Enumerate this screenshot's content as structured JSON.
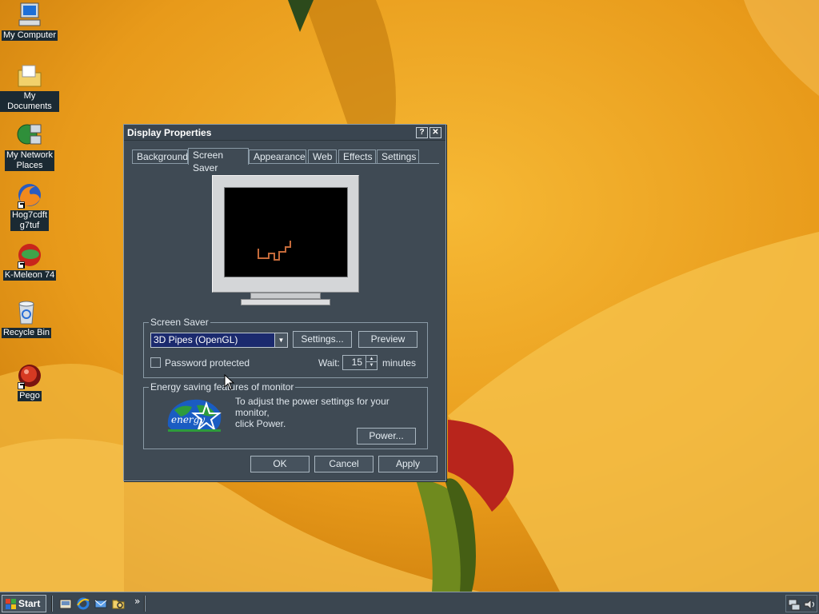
{
  "desktop": {
    "icons": [
      {
        "label": "My Computer",
        "icon": "computer-icon"
      },
      {
        "label": "My Documents",
        "icon": "folder-icon"
      },
      {
        "label": "My Network",
        "label2": "Places",
        "icon": "network-icon"
      },
      {
        "label": "Hog7cdft",
        "label2": "g7tuf",
        "icon": "firefox-icon"
      },
      {
        "label": "K-Meleon 74",
        "icon": "kmeleon-icon"
      },
      {
        "label": "Recycle Bin",
        "icon": "recycle-bin-icon"
      },
      {
        "label": "Pego",
        "icon": "pego-icon"
      }
    ]
  },
  "dialog": {
    "title": "Display Properties",
    "help_label": "?",
    "close_label": "✕",
    "tabs": [
      "Background",
      "Screen Saver",
      "Appearance",
      "Web",
      "Effects",
      "Settings"
    ],
    "active_tab": "Screen Saver",
    "screensaver": {
      "group_title": "Screen Saver",
      "selected": "3D Pipes (OpenGL)",
      "settings_label": "Settings...",
      "preview_label": "Preview",
      "password_label": "Password protected",
      "password_checked": false,
      "wait_label": "Wait:",
      "wait_value": "15",
      "minutes_label": "minutes"
    },
    "energy": {
      "group_title": "Energy saving features of monitor",
      "description_line1": "To adjust the power settings for your monitor,",
      "description_line2": "click Power.",
      "power_label": "Power...",
      "logo_text": "energy"
    },
    "ok_label": "OK",
    "cancel_label": "Cancel",
    "apply_label": "Apply"
  },
  "taskbar": {
    "start_label": "Start",
    "chevron_label": "»"
  },
  "colors": {
    "dialog_bg": "#3f4a54",
    "select_highlight": "#1b2a6e",
    "wallpaper_orange": "#e69f1d"
  }
}
